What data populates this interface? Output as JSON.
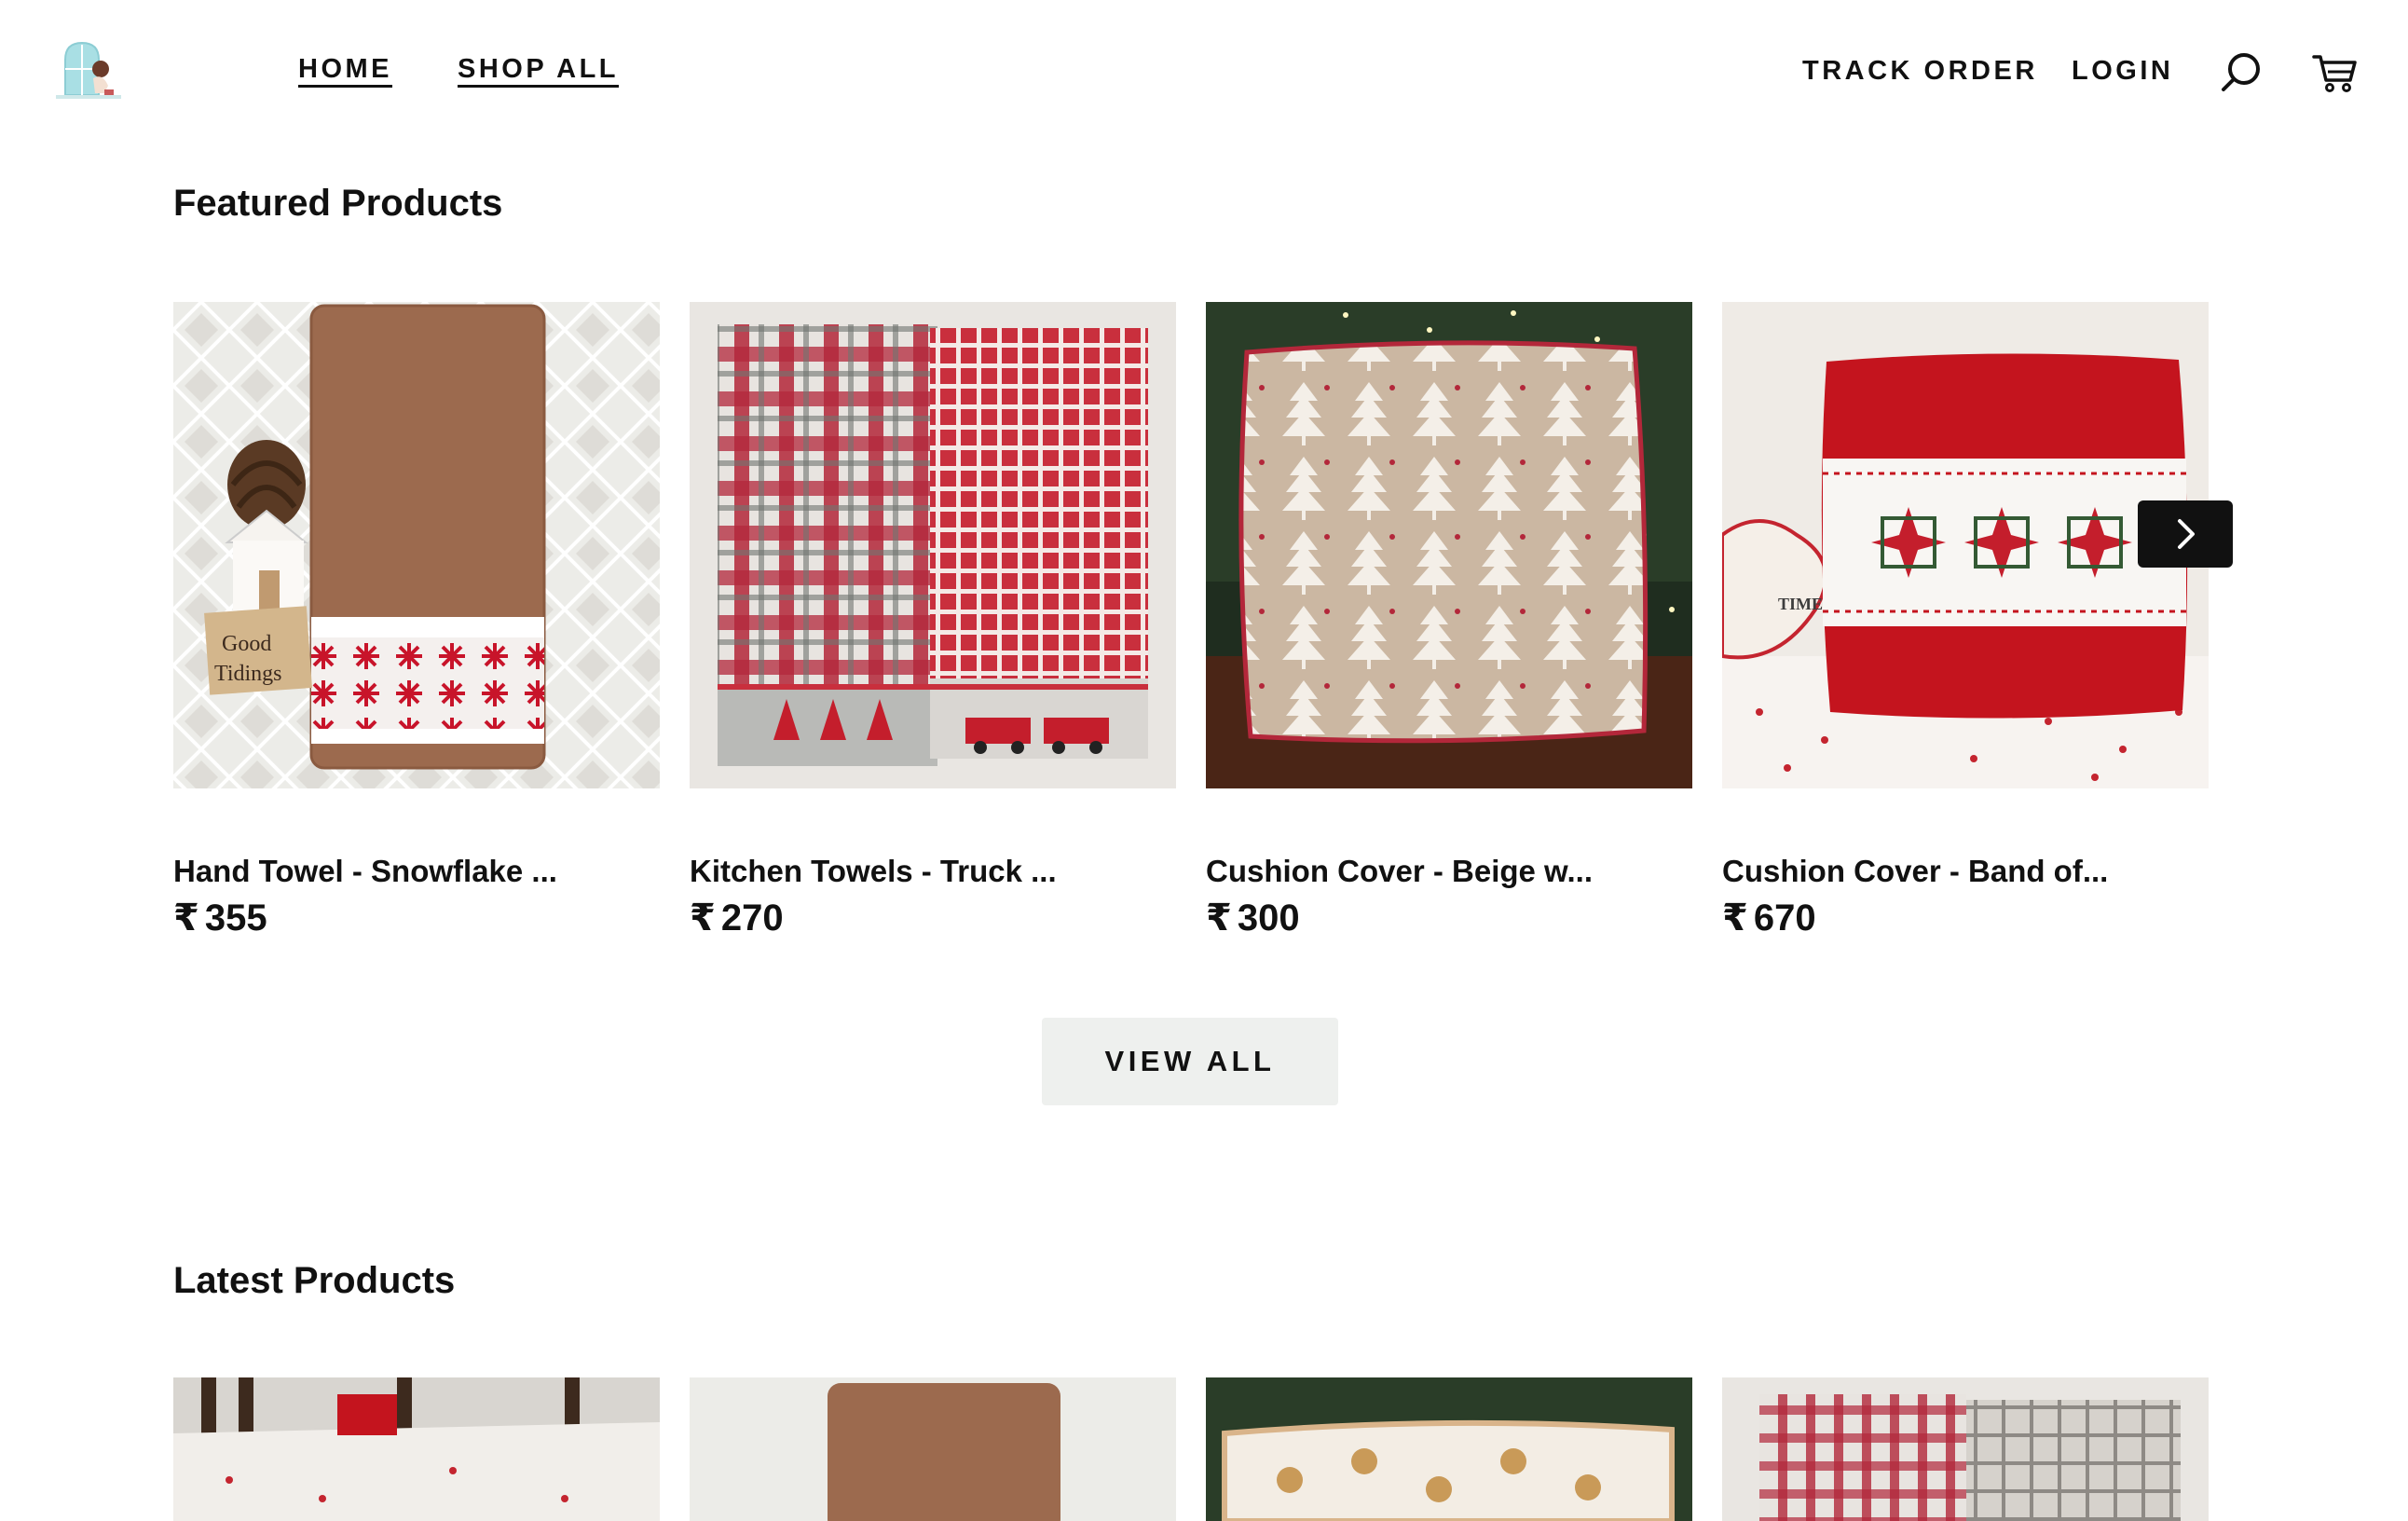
{
  "header": {
    "nav_home": "HOME",
    "nav_shop_all": "SHOP ALL",
    "nav_track_order": "TRACK ORDER",
    "nav_login": "LOGIN",
    "search_icon": "search-icon",
    "cart_icon": "cart-icon"
  },
  "featured": {
    "title": "Featured Products",
    "currency_symbol": "₹",
    "products": [
      {
        "name": "Hand Towel - Snowflake ...",
        "price": "355"
      },
      {
        "name": "Kitchen Towels - Truck ...",
        "price": "270"
      },
      {
        "name": "Cushion Cover - Beige w...",
        "price": "300"
      },
      {
        "name": "Cushion Cover - Band of...",
        "price": "670"
      }
    ],
    "next_icon": "chevron-right-icon",
    "view_all_label": "VIEW ALL"
  },
  "latest": {
    "title": "Latest Products"
  },
  "colors": {
    "text": "#111111",
    "button_bg": "#eef0ee",
    "arrow_bg": "#111111",
    "towel_brown": "#9c6a4e",
    "plaid_red": "#b3273a",
    "cushion_beige": "#cbb7a2",
    "cushion_red": "#c4141e"
  }
}
